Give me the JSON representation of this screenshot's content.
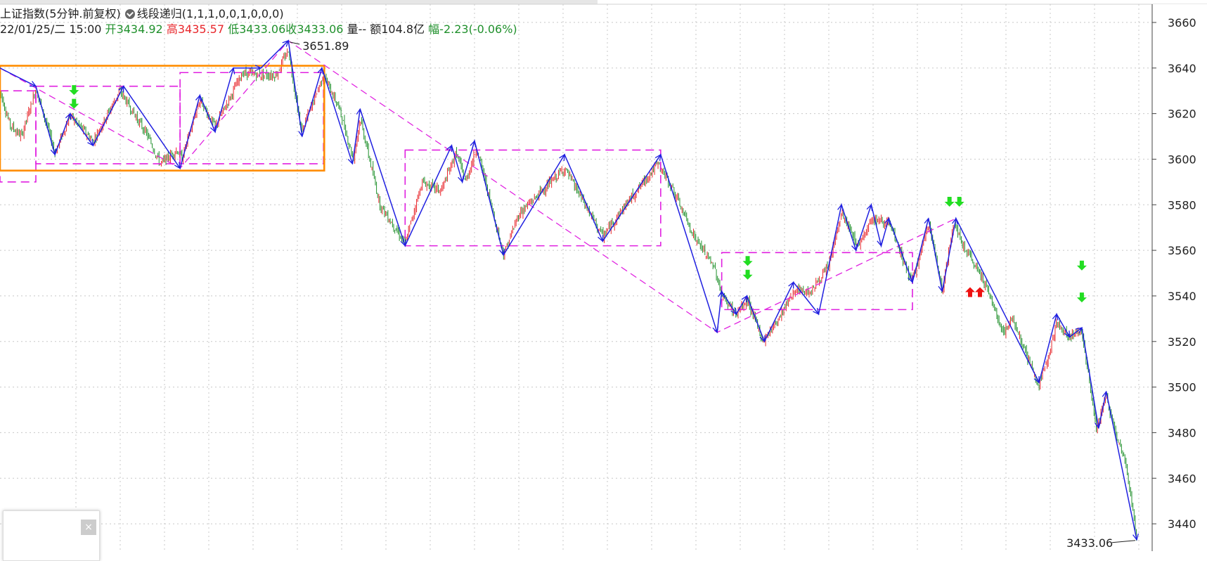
{
  "header": {
    "title": "上证指数(5分钟.前复权)",
    "indicator": "线段递归(1,1,1,0,0,1,0,0,0)",
    "datetime": "22/01/25/二 15:00",
    "open_label": "开",
    "open_value": "3434.92",
    "high_label": "高",
    "high_value": "3435.57",
    "low_label": "低",
    "low_value": "3433.06",
    "close_label": "收",
    "close_value": "3433.06",
    "volume_label": "量",
    "volume_value": "--",
    "amount_label": "额",
    "amount_value": "104.8亿",
    "change_label": "幅",
    "change_value": "-2.23(-0.06%)"
  },
  "colors": {
    "up": "#e8262b",
    "down": "#20902c",
    "stroke": "#2020e0",
    "segment": "#e020e0",
    "pivot_outer": "#ff8c00",
    "grid": "#c8c8c8",
    "signal_green": "#22dd22",
    "signal_red": "#ee1111"
  },
  "mini_panel": {
    "close_icon": "close-icon",
    "close_glyph": "×"
  },
  "chart_data": {
    "type": "candlestick",
    "ylim": [
      3428,
      3668
    ],
    "yticks": [
      3440,
      3460,
      3480,
      3500,
      3520,
      3540,
      3560,
      3580,
      3600,
      3620,
      3640,
      3660
    ],
    "x_index_range": [
      0,
      1000
    ],
    "annotations": [
      {
        "label": "3651.89",
        "type": "high"
      },
      {
        "label": "3433.06",
        "type": "low"
      }
    ],
    "close_path": [
      [
        0,
        3630
      ],
      [
        13,
        3615
      ],
      [
        28,
        3610
      ],
      [
        47,
        3631
      ],
      [
        72,
        3603
      ],
      [
        92,
        3619
      ],
      [
        122,
        3608
      ],
      [
        157,
        3630
      ],
      [
        194,
        3610
      ],
      [
        210,
        3598
      ],
      [
        232,
        3604
      ],
      [
        238,
        3600
      ],
      [
        262,
        3626
      ],
      [
        282,
        3614
      ],
      [
        298,
        3625
      ],
      [
        318,
        3638
      ],
      [
        340,
        3637
      ],
      [
        362,
        3637
      ],
      [
        378,
        3648
      ],
      [
        395,
        3612
      ],
      [
        424,
        3637
      ],
      [
        445,
        3622
      ],
      [
        463,
        3600
      ],
      [
        472,
        3618
      ],
      [
        498,
        3580
      ],
      [
        531,
        3563
      ],
      [
        553,
        3590
      ],
      [
        578,
        3586
      ],
      [
        598,
        3603
      ],
      [
        610,
        3590
      ],
      [
        625,
        3605
      ],
      [
        660,
        3558
      ],
      [
        680,
        3576
      ],
      [
        740,
        3596
      ],
      [
        790,
        3566
      ],
      [
        820,
        3580
      ],
      [
        862,
        3598
      ],
      [
        880,
        3588
      ],
      [
        910,
        3566
      ],
      [
        937,
        3552
      ],
      [
        946,
        3540
      ],
      [
        965,
        3532
      ],
      [
        980,
        3538
      ],
      [
        1000,
        3520
      ],
      [
        1020,
        3530
      ],
      [
        1040,
        3542
      ],
      [
        1062,
        3542
      ],
      [
        1085,
        3552
      ],
      [
        1103,
        3576
      ],
      [
        1125,
        3562
      ],
      [
        1142,
        3574
      ],
      [
        1165,
        3572
      ],
      [
        1195,
        3546
      ],
      [
        1218,
        3572
      ],
      [
        1235,
        3542
      ],
      [
        1250,
        3572
      ],
      [
        1262,
        3562
      ],
      [
        1288,
        3548
      ],
      [
        1315,
        3524
      ],
      [
        1328,
        3530
      ],
      [
        1350,
        3510
      ],
      [
        1362,
        3500
      ],
      [
        1385,
        3528
      ],
      [
        1402,
        3522
      ],
      [
        1418,
        3525
      ],
      [
        1437,
        3482
      ],
      [
        1450,
        3496
      ],
      [
        1462,
        3480
      ],
      [
        1475,
        3468
      ],
      [
        1490,
        3433
      ]
    ],
    "strokes": [
      [
        [
          0,
          3640
        ],
        [
          47,
          3632
        ],
        [
          72,
          3602
        ],
        [
          92,
          3620
        ],
        [
          122,
          3606
        ],
        [
          162,
          3632
        ],
        [
          236,
          3596
        ],
        [
          262,
          3628
        ],
        [
          282,
          3612
        ],
        [
          306,
          3640
        ],
        [
          342,
          3640
        ],
        [
          378,
          3652
        ],
        [
          396,
          3610
        ],
        [
          422,
          3640
        ],
        [
          462,
          3598
        ],
        [
          472,
          3622
        ],
        [
          531,
          3562
        ],
        [
          592,
          3606
        ],
        [
          606,
          3590
        ],
        [
          622,
          3608
        ],
        [
          660,
          3558
        ],
        [
          740,
          3602
        ],
        [
          790,
          3564
        ],
        [
          866,
          3602
        ],
        [
          940,
          3524
        ],
        [
          946,
          3542
        ],
        [
          965,
          3532
        ],
        [
          979,
          3540
        ],
        [
          1002,
          3520
        ],
        [
          1040,
          3546
        ],
        [
          1073,
          3532
        ],
        [
          1103,
          3580
        ],
        [
          1122,
          3560
        ],
        [
          1142,
          3580
        ],
        [
          1155,
          3562
        ],
        [
          1165,
          3574
        ],
        [
          1196,
          3546
        ],
        [
          1217,
          3574
        ],
        [
          1235,
          3542
        ],
        [
          1253,
          3574
        ],
        [
          1362,
          3502
        ],
        [
          1385,
          3532
        ],
        [
          1402,
          3522
        ],
        [
          1418,
          3526
        ],
        [
          1440,
          3482
        ],
        [
          1450,
          3498
        ],
        [
          1490,
          3433
        ]
      ]
    ],
    "segments": [
      [
        [
          0,
          3640
        ],
        [
          236,
          3596
        ],
        [
          378,
          3652
        ],
        [
          940,
          3524
        ],
        [
          1253,
          3574
        ]
      ]
    ],
    "pivots_dashed": [
      {
        "x0": 0,
        "x1": 47,
        "y0": 3590,
        "y1": 3630
      },
      {
        "x0": 47,
        "x1": 236,
        "y0": 3598,
        "y1": 3632
      },
      {
        "x0": 236,
        "x1": 424,
        "y0": 3598,
        "y1": 3638
      },
      {
        "x0": 531,
        "x1": 866,
        "y0": 3562,
        "y1": 3604
      },
      {
        "x0": 946,
        "x1": 1196,
        "y0": 3534,
        "y1": 3559
      }
    ],
    "pivots_solid": [
      {
        "x0": 0,
        "x1": 425,
        "y0": 3595,
        "y1": 3641
      }
    ],
    "signals": [
      {
        "x": 97,
        "y": 3630,
        "dir": "down",
        "color": "green",
        "count": 1
      },
      {
        "x": 97,
        "y": 3624,
        "dir": "down",
        "color": "green",
        "count": 1
      },
      {
        "x": 980,
        "y": 3555,
        "dir": "down",
        "color": "green",
        "count": 1
      },
      {
        "x": 980,
        "y": 3549,
        "dir": "down",
        "color": "green",
        "count": 1
      },
      {
        "x": 1251,
        "y": 3581,
        "dir": "down",
        "color": "green",
        "count": 2
      },
      {
        "x": 1278,
        "y": 3542,
        "dir": "up",
        "color": "red",
        "count": 2
      },
      {
        "x": 1418,
        "y": 3553,
        "dir": "down",
        "color": "green",
        "count": 1
      },
      {
        "x": 1418,
        "y": 3539,
        "dir": "down",
        "color": "green",
        "count": 1
      }
    ]
  }
}
